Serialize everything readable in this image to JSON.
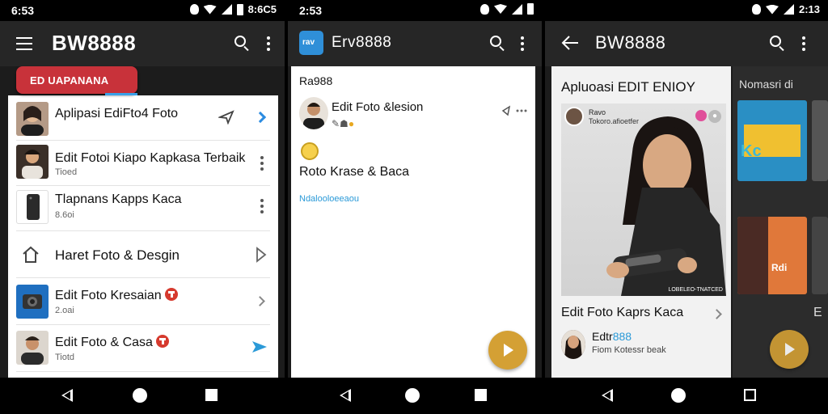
{
  "screen1": {
    "status_time": "6:53",
    "status_right": "8:6C5",
    "app_title": "BW8888",
    "chip_label": "ED UAPANANA",
    "items": [
      {
        "title": "Aplipasi EdiFto4 Foto",
        "subtitle": ""
      },
      {
        "title": "Edit Fotoi Kiapo Kapkasa Terbaik",
        "subtitle": "Tioed"
      },
      {
        "title": "Tlapnans Kapps Kaca",
        "subtitle": "8.6oi"
      },
      {
        "title": "Haret Foto & Desgin",
        "subtitle": ""
      },
      {
        "title": "Edit Foto Kresaian",
        "subtitle": "2.oai"
      },
      {
        "title": "Edit Foto & Casa",
        "subtitle": "Tiotd"
      }
    ],
    "colors": {
      "chip": "#c8323a",
      "accent": "#2b8be0"
    }
  },
  "screen2": {
    "status_time": "2:53",
    "app_title": "Erv8888",
    "app_icon_label": "rav",
    "section_label": "Ra988",
    "post_title": "Edit Foto &lesion",
    "post_sub": "Roto Krase & Baca",
    "link_text": "Ndalooloeeaou",
    "colors": {
      "fab": "#d4a034",
      "link": "#2b9ad8"
    }
  },
  "screen3": {
    "status_time": "2:13",
    "app_title": "BW8888",
    "panel_title": "Apluoasi EDIT ENIOY",
    "photo_user": "Ravo",
    "photo_caption": "Tokoro.afioetfer",
    "photo_tag": "LOBELEO-TNATCED",
    "item_title": "Edit Foto Kaprs Kaca",
    "author_name_prefix": "Edtr",
    "author_name_suffix": "888",
    "author_sub": "Fiom Kotessr beak",
    "side_title": "Nomasri di",
    "side_letter": "E",
    "posters": [
      {
        "label": "Kc",
        "color": "#2a8fc4"
      },
      {
        "label": "",
        "color": "#555"
      },
      {
        "label": "Rdi",
        "color": "#e0783a"
      },
      {
        "label": "",
        "color": "#444"
      }
    ]
  }
}
